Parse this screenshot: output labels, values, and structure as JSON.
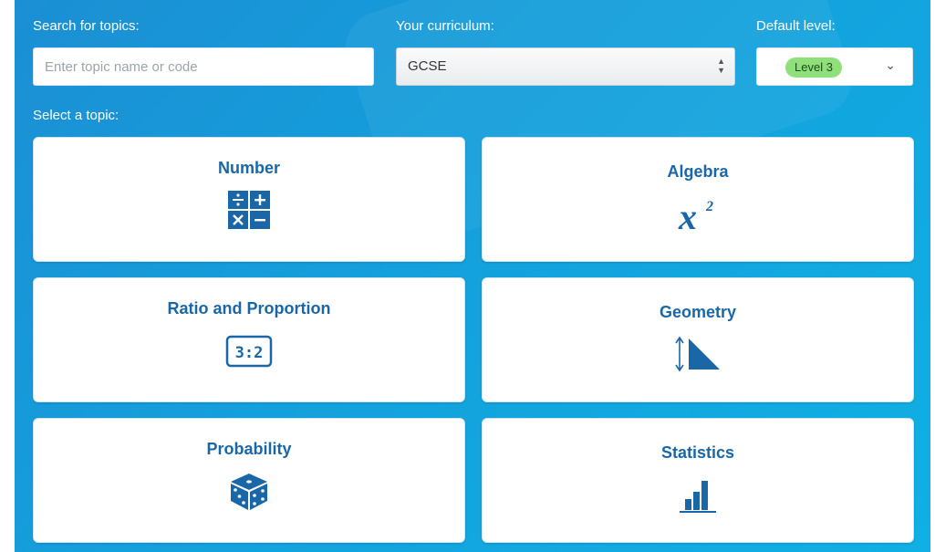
{
  "search": {
    "label": "Search for topics:",
    "placeholder": "Enter topic name or code",
    "value": ""
  },
  "curriculum": {
    "label": "Your curriculum:",
    "selected": "GCSE"
  },
  "level": {
    "label": "Default level:",
    "selected": "Level 3"
  },
  "topics_label": "Select a topic:",
  "topics": [
    {
      "title": "Number",
      "icon": "operations-grid-icon"
    },
    {
      "title": "Algebra",
      "icon": "x-squared-icon"
    },
    {
      "title": "Ratio and Proportion",
      "icon": "ratio-icon",
      "icon_text": "3:2"
    },
    {
      "title": "Geometry",
      "icon": "triangle-measure-icon"
    },
    {
      "title": "Probability",
      "icon": "dice-icon"
    },
    {
      "title": "Statistics",
      "icon": "bar-chart-icon"
    }
  ],
  "colors": {
    "background": "#14a0dc",
    "card_title": "#1a67a8",
    "icon": "#1a67a8",
    "level_pill": "#8fe07a"
  }
}
